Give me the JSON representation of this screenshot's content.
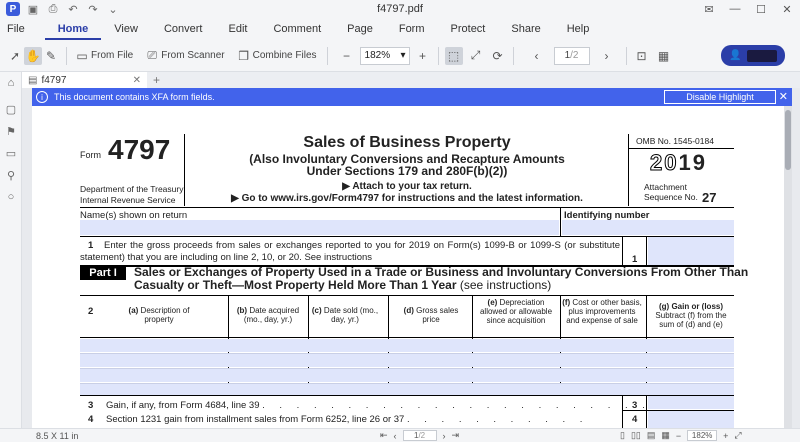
{
  "window": {
    "title": "f4797.pdf",
    "controls": [
      "mail",
      "—",
      "☐",
      "✕"
    ]
  },
  "menu": {
    "file": "File",
    "items": [
      "Home",
      "View",
      "Convert",
      "Edit",
      "Comment",
      "Page",
      "Form",
      "Protect",
      "Share",
      "Help"
    ],
    "active": "Home"
  },
  "toolbar": {
    "from_file": "From File",
    "from_scanner": "From Scanner",
    "combine_files": "Combine Files",
    "zoom": "182%",
    "page_current": "1",
    "page_total": "/2"
  },
  "tab": {
    "name": "f4797"
  },
  "banner": {
    "message": "This document contains XFA form fields.",
    "button": "Disable Highlight"
  },
  "form": {
    "form_label": "Form",
    "form_number": "4797",
    "title": "Sales of Business Property",
    "subtitle1": "(Also Involuntary Conversions and Recapture Amounts",
    "subtitle2": "Under Sections 179 and 280F(b)(2))",
    "attach": "▶ Attach to your tax return.",
    "goto": "▶ Go to www.irs.gov/Form4797 for instructions and the latest information.",
    "department": "Department of the Treasury",
    "irs": "Internal Revenue Service",
    "omb": "OMB No. 1545-0184",
    "year_prefix": "20",
    "year_suffix": "19",
    "attachment": "Attachment",
    "sequence": "Sequence No.",
    "sequence_num": "27",
    "name_label": "Name(s) shown on return",
    "id_label": "Identifying number",
    "line1_num": "1",
    "line1_text": "Enter the gross proceeds from sales or exchanges reported to you for 2019 on Form(s) 1099-B or 1099-S (or substitute statement) that you are including on line 2, 10, or 20. See instructions",
    "line1_box": "1",
    "part_tag": "Part I",
    "part_title": "Sales or Exchanges of Property Used in a Trade or Business and Involuntary Conversions From Other Than Casualty or Theft—Most Property Held More Than 1 Year",
    "part_note": "(see instructions)",
    "line2_num": "2",
    "columns": [
      {
        "key": "(a)",
        "label": "Description of property"
      },
      {
        "key": "(b)",
        "label": "Date acquired (mo., day, yr.)"
      },
      {
        "key": "(c)",
        "label": "Date sold (mo., day, yr.)"
      },
      {
        "key": "(d)",
        "label": "Gross sales price"
      },
      {
        "key": "(e)",
        "label": "Depreciation allowed or allowable since acquisition"
      },
      {
        "key": "(f)",
        "label": "Cost or other basis, plus improvements and expense of sale"
      },
      {
        "key": "(g) Gain or (loss)",
        "label": "Subtract (f) from the sum of (d) and (e)"
      }
    ],
    "line3_num": "3",
    "line3_text": "Gain, if any, from Form 4684, line 39",
    "line3_box": "3",
    "line4_num": "4",
    "line4_text": "Section 1231 gain from installment sales from Form 6252, line 26 or 37",
    "line4_box": "4"
  },
  "status": {
    "page_size": "8.5 X 11 in",
    "page": "1",
    "page_total": "/2",
    "zoom": "182%"
  },
  "colors": {
    "accent": "#2b3ea8",
    "banner": "#4263eb",
    "field_fill": "#dfe5fb"
  }
}
